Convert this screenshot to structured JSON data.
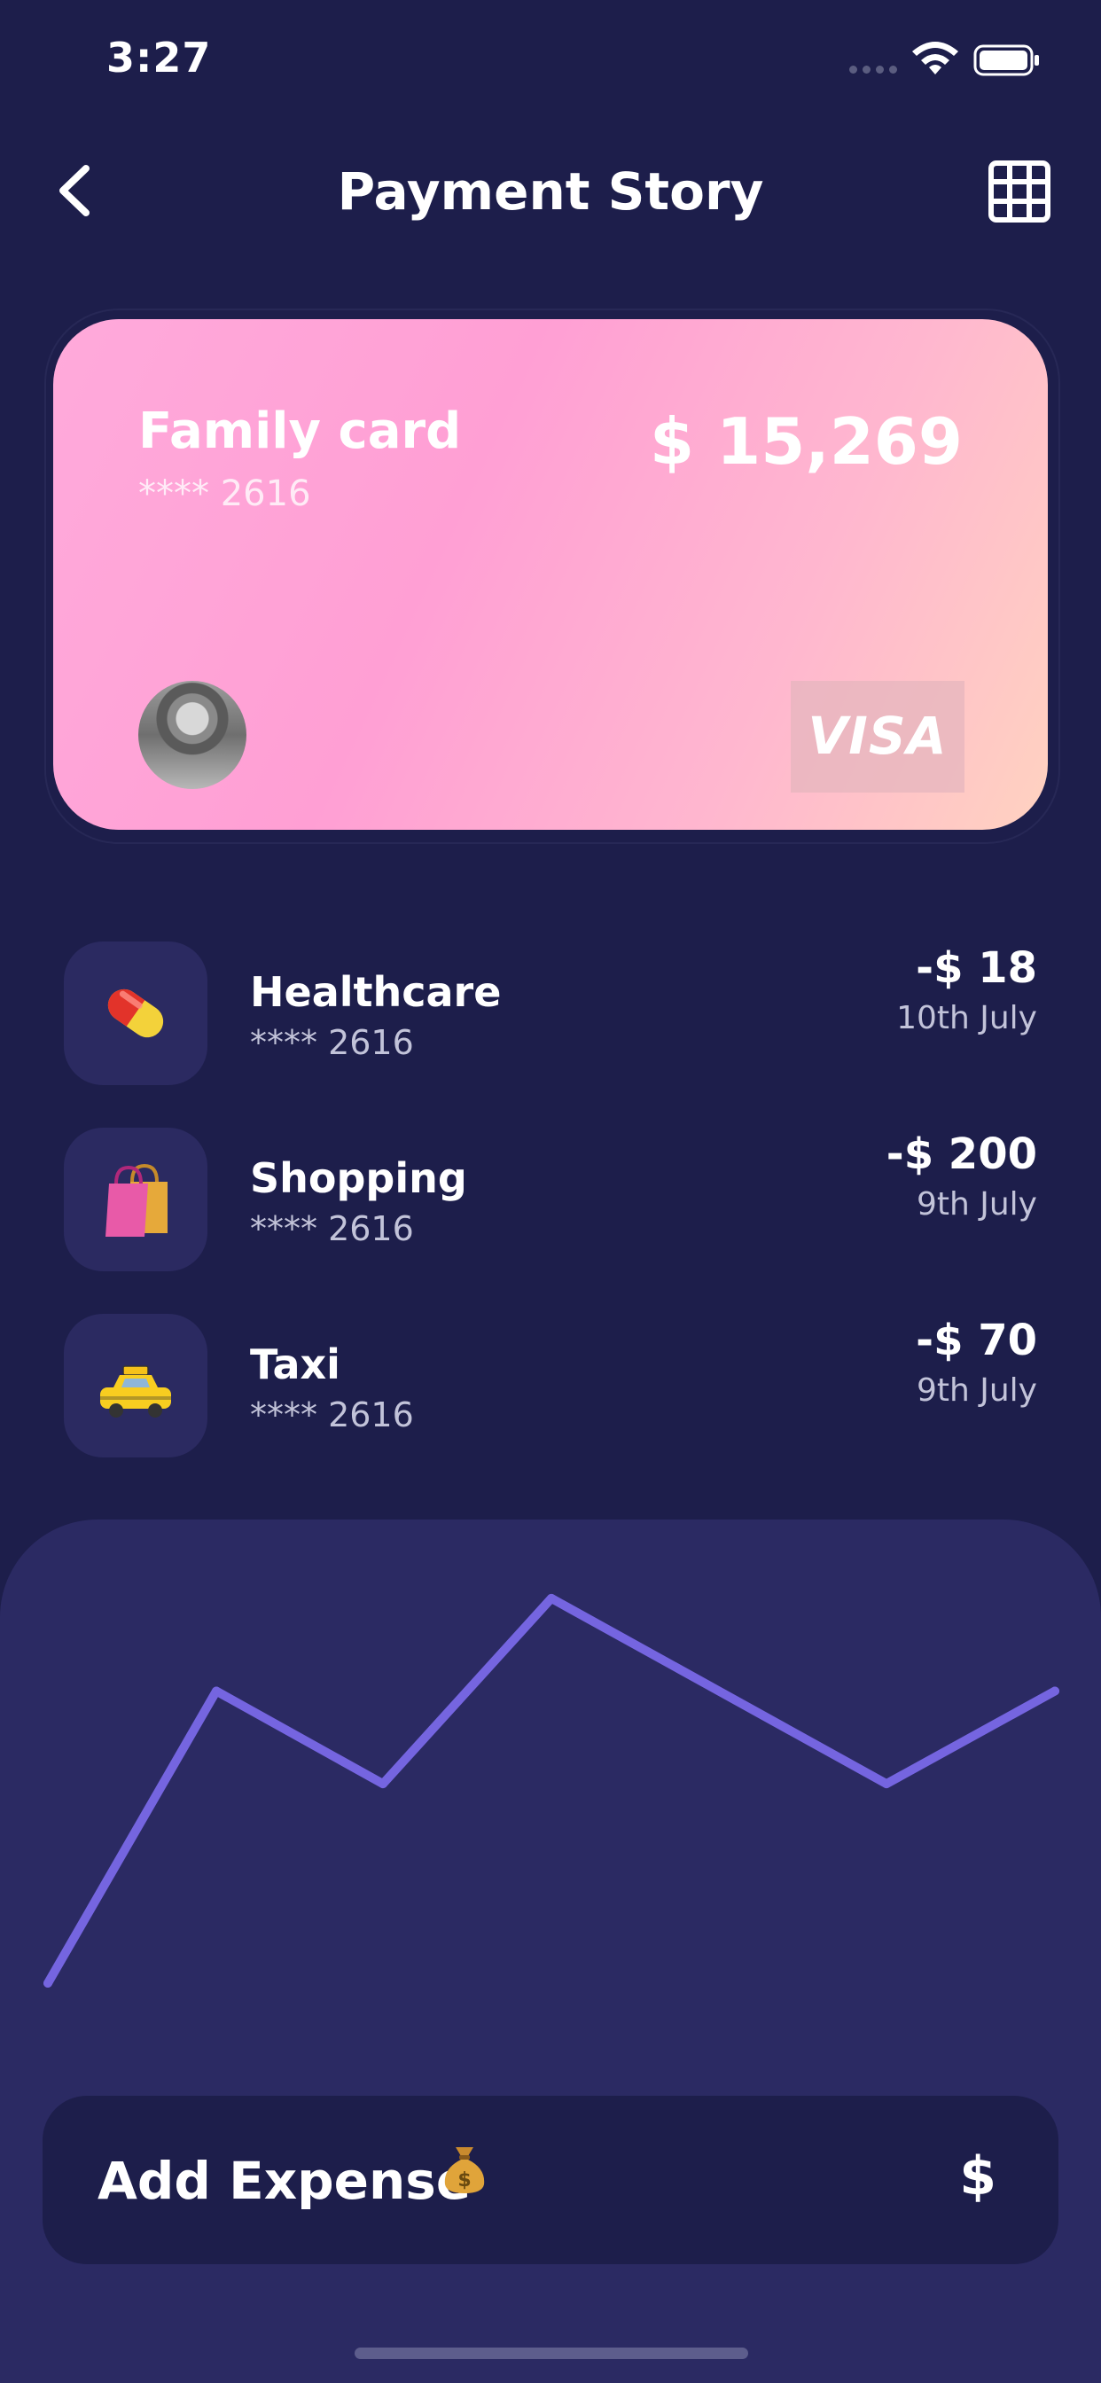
{
  "status_bar": {
    "time": "3:27"
  },
  "header": {
    "title": "Payment Story"
  },
  "card": {
    "name": "Family card",
    "number": "**** 2616",
    "balance": "$ 15,269",
    "brand": "VISA"
  },
  "transactions": [
    {
      "title": "Healthcare",
      "number": "**** 2616",
      "amount": "-$ 18",
      "date": "10th July",
      "icon": "pill-icon"
    },
    {
      "title": "Shopping",
      "number": "**** 2616",
      "amount": "-$ 200",
      "date": "9th July",
      "icon": "shopping-bags-icon"
    },
    {
      "title": "Taxi",
      "number": "**** 2616",
      "amount": "-$ 70",
      "date": "9th July",
      "icon": "taxi-icon"
    }
  ],
  "chart_data": {
    "type": "line",
    "series": [
      {
        "values": [
          0,
          63,
          43,
          83,
          43,
          63
        ]
      }
    ],
    "color": "#7565e0",
    "grid": false
  },
  "actions": {
    "add_expense_label": "Add Expense",
    "dollar_label": "$"
  },
  "colors": {
    "background": "#1d1e4b",
    "panel": "#2b2a63",
    "line": "#7565e0",
    "card_gradient_start": "#ffaadb",
    "card_gradient_end": "#ffd2c0"
  }
}
